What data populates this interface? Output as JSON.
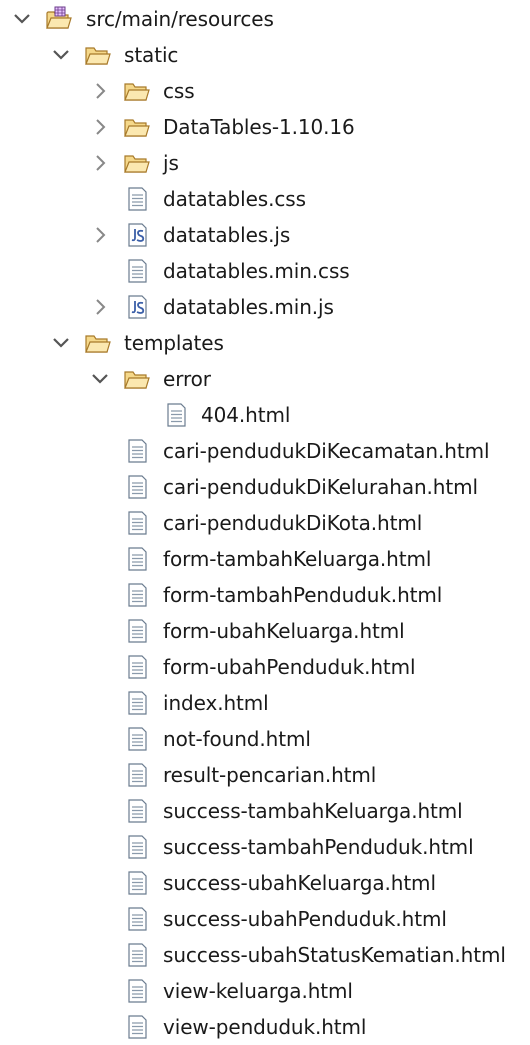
{
  "tree": {
    "root": {
      "label": "src/main/resources",
      "expanded": true,
      "icon": "package-folder-icon"
    },
    "static": {
      "label": "static",
      "expanded": true,
      "icon": "open-folder-icon",
      "items": [
        {
          "label": "css",
          "type": "folder",
          "expanded": false
        },
        {
          "label": "DataTables-1.10.16",
          "type": "folder",
          "expanded": false
        },
        {
          "label": "js",
          "type": "folder",
          "expanded": false
        },
        {
          "label": "datatables.css",
          "type": "file"
        },
        {
          "label": "datatables.js",
          "type": "jsfile",
          "expandable": true
        },
        {
          "label": "datatables.min.css",
          "type": "file"
        },
        {
          "label": "datatables.min.js",
          "type": "jsfile",
          "expandable": true
        }
      ]
    },
    "templates": {
      "label": "templates",
      "expanded": true,
      "icon": "open-folder-icon",
      "error": {
        "label": "error",
        "expanded": true,
        "items": [
          {
            "label": "404.html",
            "type": "file"
          }
        ]
      },
      "items": [
        {
          "label": "cari-pendudukDiKecamatan.html"
        },
        {
          "label": "cari-pendudukDiKelurahan.html"
        },
        {
          "label": "cari-pendudukDiKota.html"
        },
        {
          "label": "form-tambahKeluarga.html"
        },
        {
          "label": "form-tambahPenduduk.html"
        },
        {
          "label": "form-ubahKeluarga.html"
        },
        {
          "label": "form-ubahPenduduk.html"
        },
        {
          "label": "index.html"
        },
        {
          "label": "not-found.html"
        },
        {
          "label": "result-pencarian.html"
        },
        {
          "label": "success-tambahKeluarga.html"
        },
        {
          "label": "success-tambahPenduduk.html"
        },
        {
          "label": "success-ubahKeluarga.html"
        },
        {
          "label": "success-ubahPenduduk.html"
        },
        {
          "label": "success-ubahStatusKematian.html"
        },
        {
          "label": "view-keluarga.html"
        },
        {
          "label": "view-penduduk.html"
        }
      ]
    }
  }
}
